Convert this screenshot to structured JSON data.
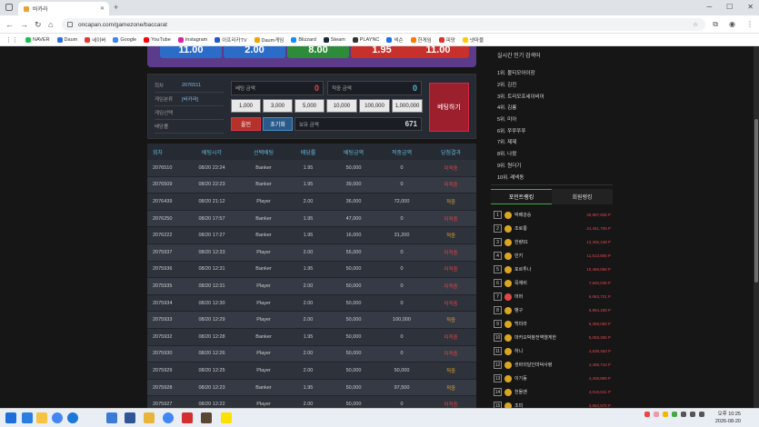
{
  "browser": {
    "tab_title": "바카라",
    "url": "oncapan.com/gamezone/baccarat"
  },
  "bookmarks": [
    {
      "label": "NAVER",
      "color": "#19c34e"
    },
    {
      "label": "Daum",
      "color": "#2d6be4"
    },
    {
      "label": "네이버",
      "color": "#e83535"
    },
    {
      "label": "Google",
      "color": "#4285f4"
    },
    {
      "label": "YouTube",
      "color": "#ff0000"
    },
    {
      "label": "Instagram",
      "color": "#d6249f"
    },
    {
      "label": "아프리카TV",
      "color": "#2457d6"
    },
    {
      "label": "Daum게임",
      "color": "#f0a500"
    },
    {
      "label": "Blizzard",
      "color": "#148eff"
    },
    {
      "label": "Steam",
      "color": "#1b2838"
    },
    {
      "label": "PLAYNC",
      "color": "#333333"
    },
    {
      "label": "넥슨",
      "color": "#1a73e8"
    },
    {
      "label": "한게임",
      "color": "#ff7900"
    },
    {
      "label": "피망",
      "color": "#e0312b"
    },
    {
      "label": "넷마블",
      "color": "#ffc90e"
    }
  ],
  "game": {
    "top_values": [
      "11.00",
      "2.00",
      "8.00",
      "1.95",
      "11.00"
    ]
  },
  "bet": {
    "round_label": "회차",
    "round_value": "2076511",
    "type_label": "게임분류",
    "type_value": "[바카라]",
    "choice_label": "게임선택",
    "odds_label": "배당률",
    "bet_amount_label": "베팅 금액",
    "bet_amount_value": "0",
    "hit_amount_label": "적중 금액",
    "hit_amount_value": "0",
    "chips": [
      "1,000",
      "3,000",
      "5,000",
      "10,000",
      "100,000",
      "1,000,000"
    ],
    "allin_label": "올인",
    "reset_label": "초기화",
    "hold_label": "보유 금액",
    "hold_value": "671",
    "submit_label": "베팅하기"
  },
  "history": {
    "headers": [
      "회차",
      "베팅시각",
      "선택배팅",
      "배당률",
      "베팅금액",
      "적중금액",
      "당첨결과"
    ],
    "rows": [
      {
        "round": "2076510",
        "time": "08/20 22:24",
        "pick": "Banker",
        "odds": "1.95",
        "bet": "50,000",
        "hit": "0",
        "result": "미적중",
        "win": false
      },
      {
        "round": "2076509",
        "time": "08/20 22:23",
        "pick": "Banker",
        "odds": "1.95",
        "bet": "39,000",
        "hit": "0",
        "result": "미적중",
        "win": false
      },
      {
        "round": "2076439",
        "time": "08/20 21:12",
        "pick": "Player",
        "odds": "2.00",
        "bet": "36,000",
        "hit": "72,000",
        "result": "적중",
        "win": true
      },
      {
        "round": "2076250",
        "time": "08/20 17:57",
        "pick": "Banker",
        "odds": "1.95",
        "bet": "47,000",
        "hit": "0",
        "result": "미적중",
        "win": false
      },
      {
        "round": "2076222",
        "time": "08/20 17:27",
        "pick": "Banker",
        "odds": "1.95",
        "bet": "16,000",
        "hit": "31,200",
        "result": "적중",
        "win": true
      },
      {
        "round": "2075937",
        "time": "08/20 12:33",
        "pick": "Player",
        "odds": "2.00",
        "bet": "55,000",
        "hit": "0",
        "result": "미적중",
        "win": false
      },
      {
        "round": "2075936",
        "time": "08/20 12:31",
        "pick": "Banker",
        "odds": "1.95",
        "bet": "50,000",
        "hit": "0",
        "result": "미적중",
        "win": false
      },
      {
        "round": "2075935",
        "time": "08/20 12:31",
        "pick": "Player",
        "odds": "2.00",
        "bet": "50,000",
        "hit": "0",
        "result": "미적중",
        "win": false
      },
      {
        "round": "2075934",
        "time": "08/20 12:30",
        "pick": "Player",
        "odds": "2.00",
        "bet": "50,000",
        "hit": "0",
        "result": "미적중",
        "win": false
      },
      {
        "round": "2075933",
        "time": "08/20 12:29",
        "pick": "Player",
        "odds": "2.00",
        "bet": "50,000",
        "hit": "100,000",
        "result": "적중",
        "win": true
      },
      {
        "round": "2075932",
        "time": "08/20 12:28",
        "pick": "Banker",
        "odds": "1.95",
        "bet": "50,000",
        "hit": "0",
        "result": "미적중",
        "win": false
      },
      {
        "round": "2075930",
        "time": "08/20 12:26",
        "pick": "Player",
        "odds": "2.00",
        "bet": "50,000",
        "hit": "0",
        "result": "미적중",
        "win": false
      },
      {
        "round": "2075929",
        "time": "08/20 12:25",
        "pick": "Player",
        "odds": "2.00",
        "bet": "50,000",
        "hit": "50,000",
        "result": "적중",
        "win": true
      },
      {
        "round": "2075928",
        "time": "08/20 12:23",
        "pick": "Banker",
        "odds": "1.95",
        "bet": "50,000",
        "hit": "97,500",
        "result": "적중",
        "win": true
      },
      {
        "round": "2075927",
        "time": "08/20 12:22",
        "pick": "Player",
        "odds": "2.00",
        "bet": "50,000",
        "hit": "0",
        "result": "미적중",
        "win": false
      }
    ]
  },
  "sidebar": {
    "search_title": "실시간 인기 검색어",
    "search_items": [
      "1위. 볼티모어이장",
      "2위. 김진",
      "3위. 트리모프세이비어",
      "4위. 김룡",
      "5위. 미아",
      "6위. 쭈쭈쭈쭈",
      "7위. 제제",
      "8위. 나왔",
      "9위. 원더기",
      "10위. 레넥동"
    ],
    "tab_point": "포인트랭킹",
    "tab_member": "회원랭킹",
    "ranking": [
      {
        "rank": "1",
        "name": "박배강승",
        "points": "30,987,935 P"
      },
      {
        "rank": "2",
        "name": "조로롱",
        "points": "24,461,705 P"
      },
      {
        "rank": "3",
        "name": "한량91",
        "points": "13,355,138 P"
      },
      {
        "rank": "4",
        "name": "빈키",
        "points": "11,513,805 P"
      },
      {
        "rank": "5",
        "name": "포르투나",
        "points": "10,468,068 P"
      },
      {
        "rank": "6",
        "name": "목재비",
        "points": "7,940,048 P"
      },
      {
        "rank": "7",
        "name": "머머",
        "points": "6,063,721 P"
      },
      {
        "rank": "8",
        "name": "뱅구",
        "points": "5,984,188 P"
      },
      {
        "rank": "9",
        "name": "백미라",
        "points": "5,368,088 P"
      },
      {
        "rank": "10",
        "name": "마카오박참전역열게한",
        "points": "5,059,256 P"
      },
      {
        "rank": "11",
        "name": "하니",
        "points": "4,638,463 P"
      },
      {
        "rank": "12",
        "name": "생바의달인마덕사령",
        "points": "4,498,744 P"
      },
      {
        "rank": "13",
        "name": "이기동",
        "points": "4,408,889 P"
      },
      {
        "rank": "14",
        "name": "천돌맨",
        "points": "4,019,031 P"
      },
      {
        "rank": "15",
        "name": "조미",
        "points": "3,983,978 P"
      }
    ]
  },
  "taskbar": {
    "time": "오후 10:25",
    "date": "2026-08-20"
  }
}
